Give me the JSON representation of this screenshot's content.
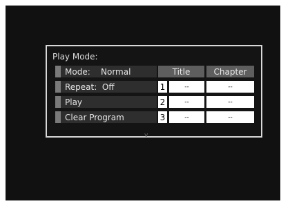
{
  "panel": {
    "title": "Play Mode:",
    "options": [
      {
        "label": "Mode:    Normal"
      },
      {
        "label": "Repeat:  Off"
      },
      {
        "label": "Play"
      },
      {
        "label": "Clear Program"
      }
    ],
    "columns": {
      "title": "Title",
      "chapter": "Chapter"
    },
    "program": [
      {
        "num": "1",
        "title": "--",
        "chapter": "--"
      },
      {
        "num": "2",
        "title": "--",
        "chapter": "--"
      },
      {
        "num": "3",
        "title": "--",
        "chapter": "--"
      }
    ],
    "caret": "v"
  },
  "colors": {
    "background": "#111111",
    "panel_border": "#d8d8d8",
    "option_bg": "#2e2e2e",
    "header_bg": "#5e5e5e",
    "cell_bg": "#ffffff"
  }
}
